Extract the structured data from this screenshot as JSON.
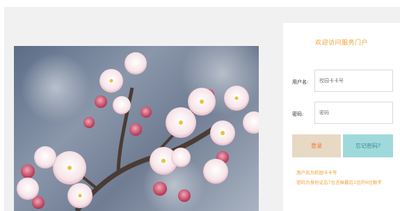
{
  "panel": {
    "welcome": "欢迎访问服务门户",
    "username_label": "用户名:",
    "username_placeholder": "校园卡卡号",
    "password_label": "密码:",
    "password_placeholder": "密码",
    "login_button": "登录",
    "forgot_button": "忘记密码?",
    "hint_1": "用户名为校园卡卡号",
    "hint_2": "密码为身份证后7位去掉最后1位的6位数字"
  },
  "photo": {
    "subject": "apricot-blossom-photo"
  },
  "colors": {
    "accent_orange": "#f0a239",
    "login_bg": "#e8d9c5",
    "forgot_bg": "#9fd9dc",
    "page_bg": "#f1f1f1"
  }
}
